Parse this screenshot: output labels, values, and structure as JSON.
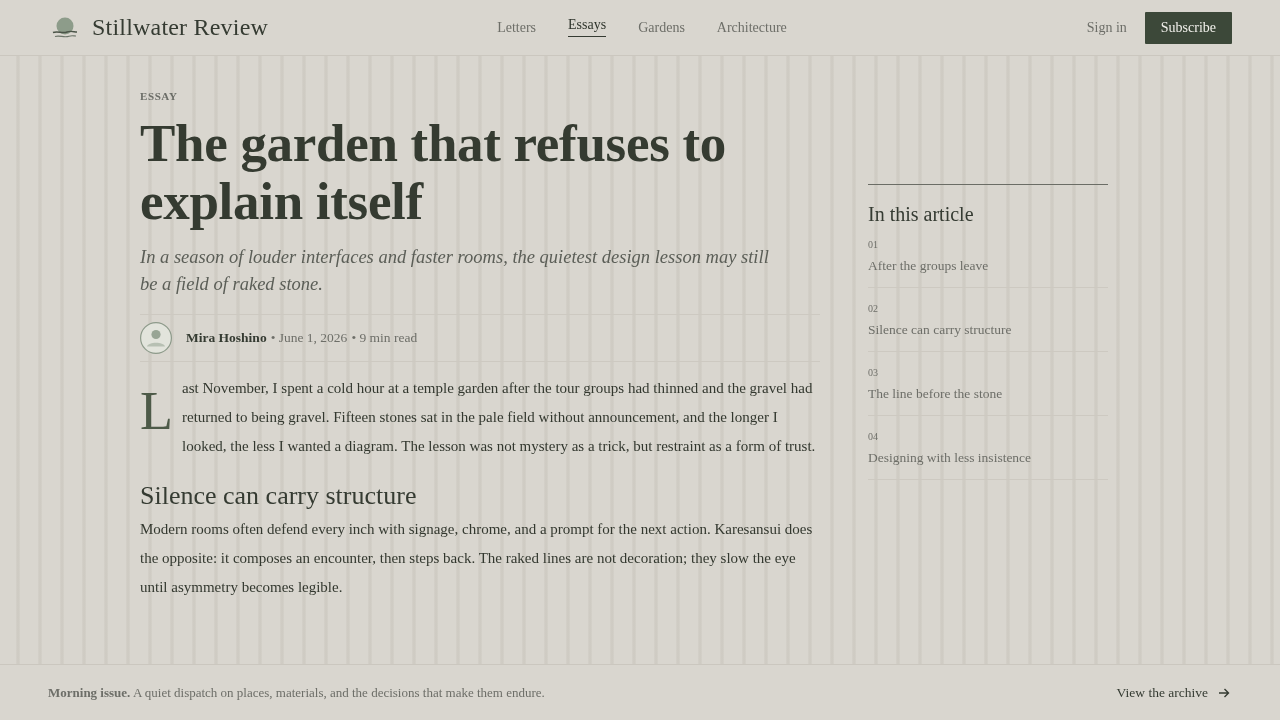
{
  "header": {
    "brand": "Stillwater Review",
    "nav": [
      {
        "label": "Letters",
        "selected": false
      },
      {
        "label": "Essays",
        "selected": true
      },
      {
        "label": "Gardens",
        "selected": false
      },
      {
        "label": "Architecture",
        "selected": false
      }
    ],
    "sign_in": "Sign in",
    "subscribe": "Subscribe"
  },
  "article": {
    "kicker": "ESSAY",
    "title": "The garden that refuses to explain itself",
    "dek": "In a season of louder interfaces and faster rooms, the quietest design lesson may still be a field of raked stone.",
    "byline": {
      "author": "Mira Hoshino",
      "meta": [
        "• June 1, 2026",
        "• 9 min read"
      ]
    },
    "body": [
      {
        "kind": "drop_cap_paragraph",
        "drop_cap": "L",
        "text": "ast November, I spent a cold hour at a temple garden after the tour groups had thinned and the gravel had returned to being gravel. Fifteen stones sat in the pale field without announcement, and the longer I looked, the less I wanted a diagram. The lesson was not mystery as a trick, but restraint as a form of trust."
      },
      {
        "kind": "heading",
        "text": "Silence can carry structure"
      },
      {
        "kind": "paragraph",
        "text": "Modern rooms often defend every inch with signage, chrome, and a prompt for the next action. Karesansui does the opposite: it composes an encounter, then steps back. The raked lines are not decoration; they slow the eye until asymmetry becomes legible."
      }
    ]
  },
  "toc": {
    "title": "In this article",
    "items": [
      {
        "number": "01",
        "label": "After the groups leave"
      },
      {
        "number": "02",
        "label": "Silence can carry structure"
      },
      {
        "number": "03",
        "label": "The line before the stone"
      },
      {
        "number": "04",
        "label": "Designing with less insistence"
      }
    ]
  },
  "footer": {
    "note": "**Morning issue.** A quiet dispatch on places, materials, and the decisions that make them endure.",
    "link": "View the archive"
  }
}
